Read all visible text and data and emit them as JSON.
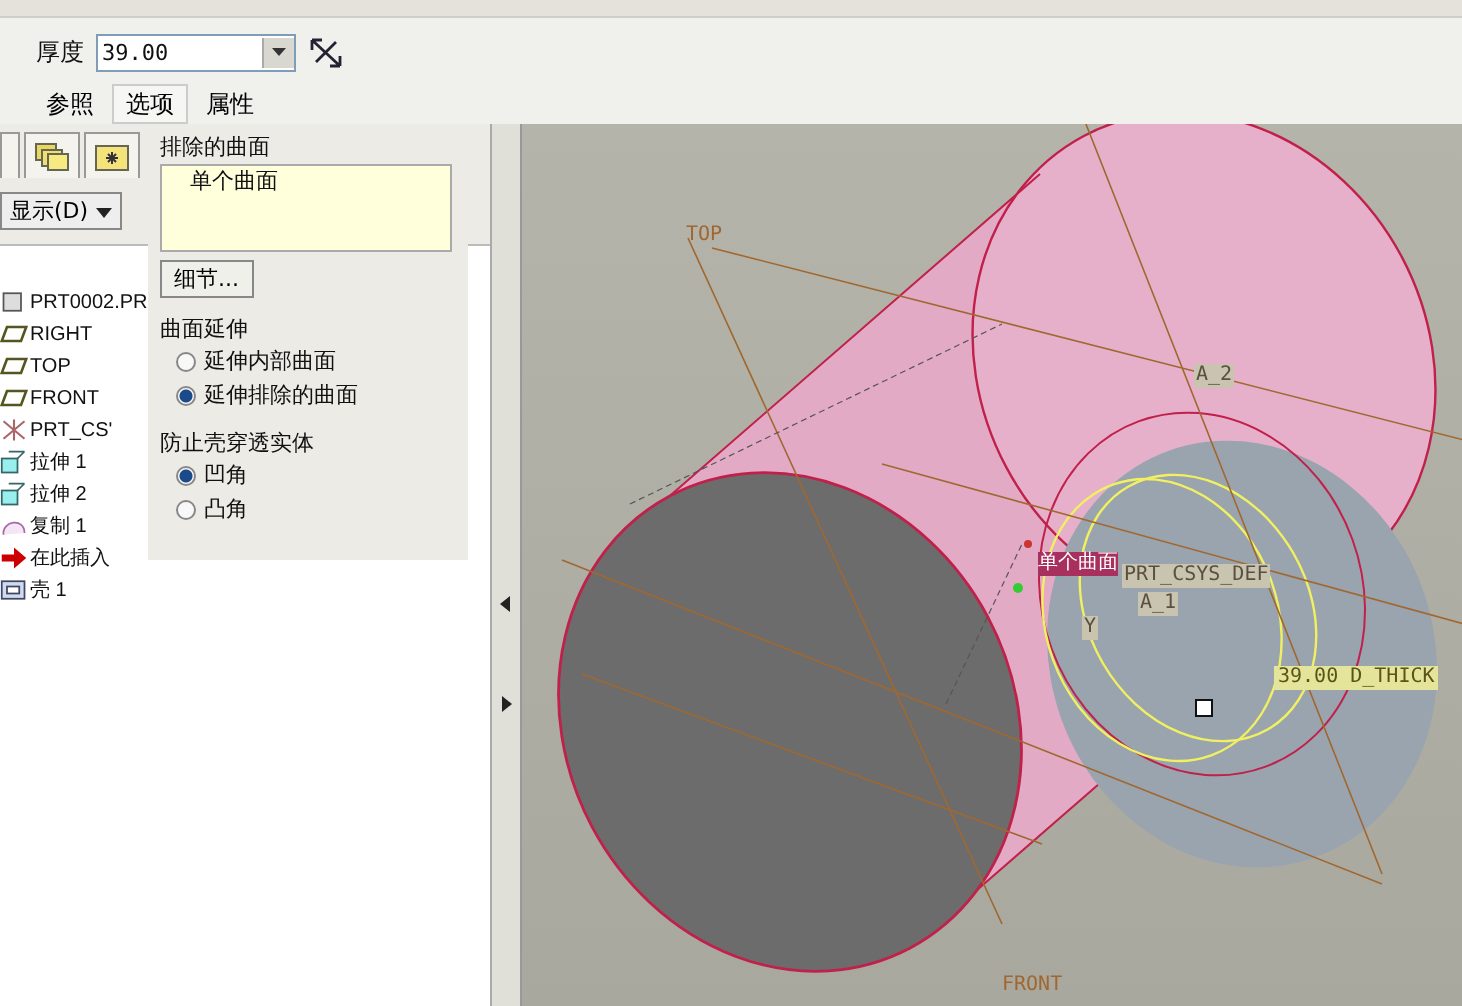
{
  "toolbar": {
    "thickness_label": "厚度",
    "thickness_value": "39.00"
  },
  "tabs": [
    {
      "label": "参照",
      "selected": false
    },
    {
      "label": "选项",
      "selected": true
    },
    {
      "label": "属性",
      "selected": false
    }
  ],
  "options_panel": {
    "excluded_label": "排除的曲面",
    "excluded_items": [
      "单个曲面"
    ],
    "details_button": "细节...",
    "extend_heading": "曲面延伸",
    "extend_options": [
      {
        "label": "延伸内部曲面",
        "selected": false
      },
      {
        "label": "延伸排除的曲面",
        "selected": true
      }
    ],
    "prevent_heading": "防止壳穿透实体",
    "prevent_options": [
      {
        "label": "凹角",
        "selected": true
      },
      {
        "label": "凸角",
        "selected": false
      }
    ]
  },
  "model_tree": {
    "show_button": "显示(D)",
    "items": [
      {
        "kind": "part",
        "label": "PRT0002.PR"
      },
      {
        "kind": "plane",
        "label": "RIGHT"
      },
      {
        "kind": "plane",
        "label": "TOP"
      },
      {
        "kind": "plane",
        "label": "FRONT"
      },
      {
        "kind": "csys",
        "label": "PRT_CS'"
      },
      {
        "kind": "extrude",
        "label": "拉伸 1"
      },
      {
        "kind": "extrude",
        "label": "拉伸 2"
      },
      {
        "kind": "copy",
        "label": "复制 1"
      },
      {
        "kind": "insert",
        "label": "在此插入"
      },
      {
        "kind": "shell",
        "label": "壳 1"
      }
    ]
  },
  "viewport": {
    "labels": [
      {
        "kind": "datum",
        "text": "TOP"
      },
      {
        "kind": "tag",
        "text": "A_2"
      },
      {
        "kind": "selection",
        "text": "单个曲面"
      },
      {
        "kind": "tag",
        "text": "PRT_CSYS_DEF"
      },
      {
        "kind": "tag",
        "text": "A_1"
      },
      {
        "kind": "tag",
        "text": "Y"
      },
      {
        "kind": "dimension",
        "text": "39.00 D_THICK"
      },
      {
        "kind": "datum",
        "text": "FRONT"
      }
    ]
  }
}
